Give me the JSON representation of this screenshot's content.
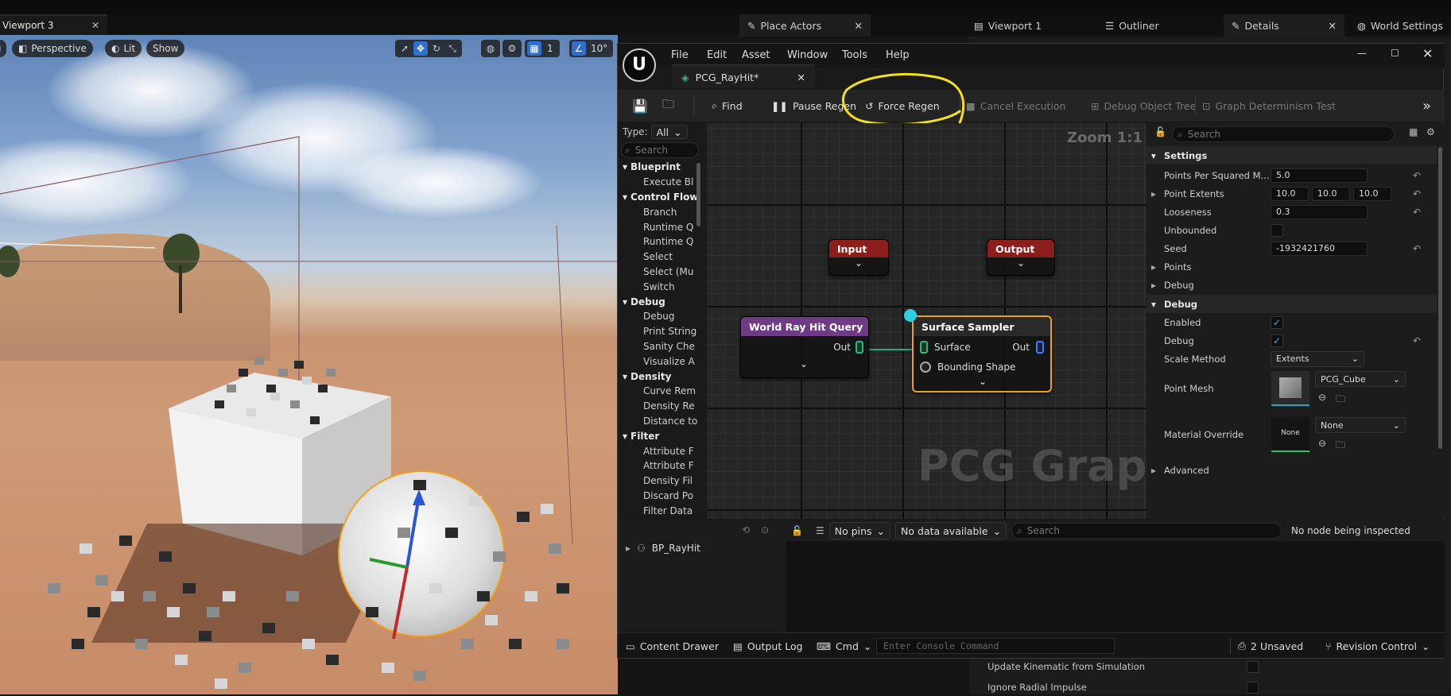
{
  "viewport": {
    "tab_label": "Viewport 3",
    "perspective_label": "Perspective",
    "lit_label": "Lit",
    "show_label": "Show",
    "grid_value": "1",
    "angle_value": "10°"
  },
  "back_tabs": {
    "place_actors": "Place Actors",
    "viewport1": "Viewport 1",
    "outliner": "Outliner",
    "details": "Details",
    "world_settings": "World Settings"
  },
  "back_details": {
    "row1": "Update Kinematic from Simulation",
    "row2": "Ignore Radial Impulse"
  },
  "pcg_window": {
    "menu": [
      "File",
      "Edit",
      "Asset",
      "Window",
      "Tools",
      "Help"
    ],
    "asset_tab": "PCG_RayHit*",
    "toolbar": {
      "find": "Find",
      "pause_regen": "Pause Regen",
      "force_regen": "Force Regen",
      "cancel_execution": "Cancel Execution",
      "debug_object_tree": "Debug Object Tree",
      "graph_determinism_test": "Graph Determinism Test"
    },
    "palette": {
      "type_label": "Type:",
      "type_value": "All",
      "search_placeholder": "Search",
      "entries": [
        {
          "kind": "cat",
          "label": "Blueprint"
        },
        {
          "kind": "item",
          "label": "Execute Bl"
        },
        {
          "kind": "cat",
          "label": "Control Flow"
        },
        {
          "kind": "item",
          "label": "Branch"
        },
        {
          "kind": "item",
          "label": "Runtime Q"
        },
        {
          "kind": "item",
          "label": "Runtime Q"
        },
        {
          "kind": "item",
          "label": "Select"
        },
        {
          "kind": "item",
          "label": "Select (Mu"
        },
        {
          "kind": "item",
          "label": "Switch"
        },
        {
          "kind": "cat",
          "label": "Debug"
        },
        {
          "kind": "item",
          "label": "Debug"
        },
        {
          "kind": "item",
          "label": "Print String"
        },
        {
          "kind": "item",
          "label": "Sanity Che"
        },
        {
          "kind": "item",
          "label": "Visualize A"
        },
        {
          "kind": "cat",
          "label": "Density"
        },
        {
          "kind": "item",
          "label": "Curve Rem"
        },
        {
          "kind": "item",
          "label": "Density Re"
        },
        {
          "kind": "item",
          "label": "Distance to"
        },
        {
          "kind": "cat",
          "label": "Filter"
        },
        {
          "kind": "item",
          "label": "Attribute F"
        },
        {
          "kind": "item",
          "label": "Attribute F"
        },
        {
          "kind": "item",
          "label": "Density Fil"
        },
        {
          "kind": "item",
          "label": "Discard Po"
        },
        {
          "kind": "item",
          "label": "Filter Data"
        }
      ]
    },
    "graph": {
      "zoom": "Zoom 1:1",
      "watermark": "PCG Graph",
      "nodes": {
        "input": "Input",
        "output": "Output",
        "world_ray": {
          "title": "World Ray Hit Query",
          "out": "Out"
        },
        "surface_sampler": {
          "title": "Surface Sampler",
          "surface": "Surface",
          "bounding_shape": "Bounding Shape",
          "out": "Out"
        }
      }
    },
    "details": {
      "search_placeholder": "Search",
      "settings_header": "Settings",
      "points_per_sq_label": "Points Per Squared M...",
      "points_per_sq_value": "5.0",
      "point_extents_label": "Point Extents",
      "point_extents": [
        "10.0",
        "10.0",
        "10.0"
      ],
      "looseness_label": "Looseness",
      "looseness_value": "0.3",
      "unbounded_label": "Unbounded",
      "seed_label": "Seed",
      "seed_value": "-1932421760",
      "points_section": "Points",
      "debug_section": "Debug",
      "debug_header": "Debug",
      "enabled_label": "Enabled",
      "debug_label": "Debug",
      "scale_method_label": "Scale Method",
      "scale_method_value": "Extents",
      "point_mesh_label": "Point Mesh",
      "point_mesh_value": "PCG_Cube",
      "material_override_label": "Material Override",
      "material_override_value": "None",
      "material_thumb_text": "None",
      "advanced_label": "Advanced"
    },
    "bottom": {
      "tree_item": "BP_RayHit",
      "pins_filter": "No pins",
      "data_filter": "No data available",
      "search_placeholder": "Search",
      "inspect_status": "No node being inspected"
    },
    "status": {
      "content_drawer": "Content Drawer",
      "output_log": "Output Log",
      "cmd": "Cmd",
      "console_placeholder": "Enter Console Command",
      "unsaved": "2 Unsaved",
      "revision_control": "Revision Control"
    }
  },
  "colors": {
    "accent_blue": "#2f6fd0",
    "input_header": "#8c1e1e",
    "world_ray_header": "#7a3f8c",
    "selection_orange": "#f0a020",
    "highlight_yellow": "#f2e21a"
  }
}
